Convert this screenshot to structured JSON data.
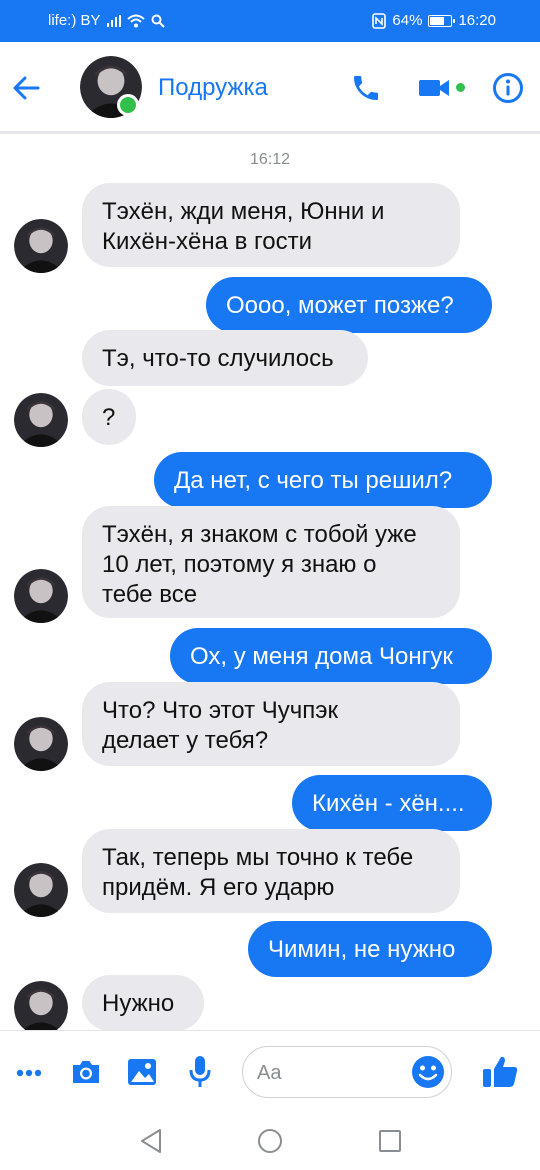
{
  "status_bar": {
    "carrier": "life:) BY",
    "battery": "64%",
    "time": "16:20",
    "icons": [
      "signal-icon",
      "wifi-icon",
      "search-icon",
      "nfc-icon",
      "battery-icon"
    ]
  },
  "header": {
    "contact_name": "Подружка",
    "online": true,
    "icons": [
      "back-arrow-icon",
      "phone-icon",
      "video-camera-icon",
      "info-icon"
    ]
  },
  "chat": {
    "timestamp": "16:12",
    "messages": [
      {
        "from": "in",
        "text_lines": [
          "Тэхён, жди меня, Юнни и",
          "Кихён-хёна в гости"
        ]
      },
      {
        "from": "out",
        "text_lines": [
          "Оооо, может позже?"
        ]
      },
      {
        "from": "in",
        "text_lines": [
          "Тэ, что-то случилось"
        ]
      },
      {
        "from": "in",
        "text_lines": [
          "?"
        ]
      },
      {
        "from": "out",
        "text_lines": [
          "Да нет, с чего ты решил?"
        ]
      },
      {
        "from": "in",
        "text_lines": [
          "Тэхён, я знаком с тобой уже",
          "10 лет, поэтому я знаю о",
          "тебе все"
        ]
      },
      {
        "from": "out",
        "text_lines": [
          "Ох, у меня дома Чонгук"
        ]
      },
      {
        "from": "in",
        "text_lines": [
          "Что? Что этот Чучпэк",
          "делает у тебя?"
        ]
      },
      {
        "from": "out",
        "text_lines": [
          "Кихён - хён...."
        ]
      },
      {
        "from": "in",
        "text_lines": [
          "Так, теперь мы точно к тебе",
          "придём. Я его ударю"
        ]
      },
      {
        "from": "out",
        "text_lines": [
          "Чимин, не нужно"
        ]
      },
      {
        "from": "in",
        "text_lines": [
          "Нужно"
        ]
      }
    ]
  },
  "composer": {
    "placeholder": "Aa",
    "icons": [
      "more-icon",
      "camera-icon",
      "gallery-icon",
      "microphone-icon",
      "emoji-icon",
      "thumbs-up-icon"
    ]
  },
  "navbar": {
    "icons": [
      "back-triangle-icon",
      "home-circle-icon",
      "recents-square-icon"
    ]
  },
  "colors": {
    "accent": "#1877f2",
    "incoming_bubble": "#e9e9ed",
    "online": "#31c04b"
  }
}
